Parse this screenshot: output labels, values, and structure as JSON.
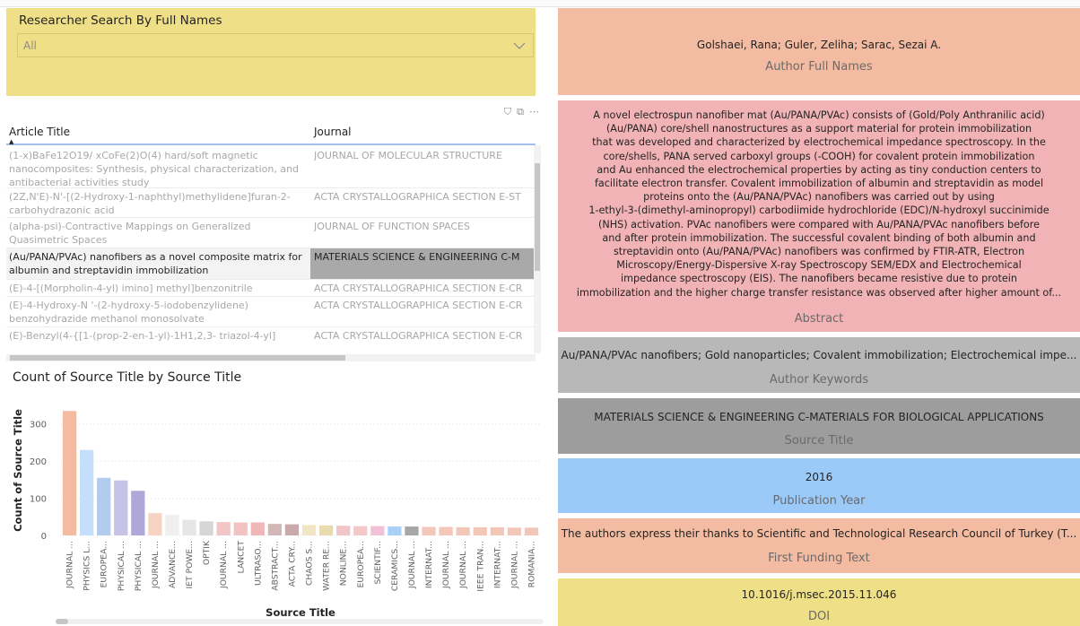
{
  "slicer": {
    "title": "Researcher Search By Full Names",
    "value": "All"
  },
  "table": {
    "headers": [
      "Article Title",
      "Journal"
    ],
    "rows": [
      {
        "title": "(1-x)BaFe12O19/ xCoFe(2)O(4) hard/soft magnetic nanocomposites: Synthesis, physical characterization, and antibacterial activities study",
        "journal": "JOURNAL OF MOLECULAR STRUCTURE"
      },
      {
        "title": "(2Z,N'E)-N'-[(2-Hydroxy-1-naphthyl)methylidene]furan-2-carbohydrazonic acid",
        "journal": "ACTA CRYSTALLOGRAPHICA SECTION E-ST"
      },
      {
        "title": "(alpha-psi)-Contractive Mappings on Generalized Quasimetric Spaces",
        "journal": "JOURNAL OF FUNCTION SPACES"
      },
      {
        "title": "(Au/PANA/PVAc) nanofibers as a novel composite matrix for albumin and streptavidin immobilization",
        "journal": "MATERIALS SCIENCE & ENGINEERING C-M"
      },
      {
        "title": "(E)-4-[(Morpholin-4-yl) imino] methyl]benzonitrile",
        "journal": "ACTA CRYSTALLOGRAPHICA SECTION E-CR"
      },
      {
        "title": "(E)-4-Hydroxy-N '-(2-hydroxy-5-iodobenzylidene) benzohydrazide methanol monosolvate",
        "journal": "ACTA CRYSTALLOGRAPHICA SECTION E-CR"
      },
      {
        "title": "(E)-Benzyl(4-{[1-(prop-2-en-1-yl)-1H1,2,3- triazol-4-yl]",
        "journal": "ACTA CRYSTALLOGRAPHICA SECTION E-CR"
      }
    ]
  },
  "chart_data": {
    "type": "bar",
    "title": "Count of Source Title by Source Title",
    "xlabel": "Source Title",
    "ylabel": "Count of Source Title",
    "ylim": [
      0,
      350
    ],
    "yticks": [
      0,
      100,
      200,
      300
    ],
    "categories": [
      "JOURNAL ...",
      "PHYSICS L...",
      "EUROPEA...",
      "PHYSICAL ...",
      "PHYSICAL ...",
      "JOURNAL ...",
      "ADVANCE...",
      "IET POWE...",
      "OPTIK",
      "JOURNAL ...",
      "LANCET",
      "ULTRASO...",
      "ABSTRACT...",
      "ACTA CRY...",
      "CHAOS S...",
      "WATER RE...",
      "NONLINE...",
      "EUROPEA...",
      "SCIENTIF...",
      "CERAMICS...",
      "JOURNAL ...",
      "INTERNAT...",
      "JOURNAL ...",
      "JOURNAL ...",
      "IEEE TRAN...",
      "INTERNAT...",
      "JOURNAL ...",
      "ROMANIA..."
    ],
    "values": [
      335,
      230,
      155,
      148,
      120,
      60,
      55,
      42,
      38,
      36,
      35,
      35,
      31,
      30,
      28,
      27,
      26,
      25,
      25,
      24,
      24,
      23,
      23,
      22,
      22,
      22,
      21,
      21
    ],
    "colors": [
      "#f3bba1",
      "#c4defb",
      "#b3cbee",
      "#c7c2e8",
      "#aea8d8",
      "#f7d3c4",
      "#efefef",
      "#e6e6e6",
      "#d6d6d6",
      "#f2c6c6",
      "#f3c3c4",
      "#f0b7b9",
      "#d3b6b6",
      "#c9a9a9",
      "#f1e5c3",
      "#e8dbb0",
      "#f2c5c8",
      "#f3c8c8",
      "#f2c1d7",
      "#a9d1f7",
      "#a7a7a7",
      "#f3c7b8",
      "#f3c7b8",
      "#f3c7b8",
      "#f3c7b8",
      "#f3c7b8",
      "#f3c7b8",
      "#f3c7b8"
    ]
  },
  "cards": {
    "author": {
      "value": "Golshaei, Rana; Guler, Zeliha; Sarac, Sezai A.",
      "label": "Author Full Names"
    },
    "abstract": {
      "lines": [
        "A novel electrospun nanofiber mat (Au/PANA/PVAc) consists of (Gold/Poly Anthranilic acid)",
        "(Au/PANA) core/shell nanostructures as a support material for protein immobilization",
        "that was developed and characterized by electrochemical impedance spectroscopy. In the",
        "core/shells, PANA served carboxyl groups (-COOH) for covalent protein immobilization",
        "and Au enhanced the electrochemical properties by acting as tiny conduction centers to",
        "facilitate electron transfer. Covalent immobilization of albumin and streptavidin as model",
        "proteins onto the (Au/PANA/PVAc) nanofibers was carried out by using",
        "1-ethyl-3-(dimethyl-aminopropyl) carbodiimide hydrochloride (EDC)/N-hydroxyl succinimide",
        "(NHS) activation. PVAc nanofibers were compared with Au/PANA/PVAc nanofibers before",
        "and after protein immobilization. The successful covalent binding of both albumin and",
        "streptavidin onto (Au/PANA/PVAc) nanofibers was confirmed by FTIR-ATR, Electron",
        "Microscopy/Energy-Dispersive X-ray Spectroscopy SEM/EDX and Electrochemical",
        "impedance spectroscopy (EIS). The nanofibers became resistive due to protein",
        "immobilization and the higher charge transfer resistance was observed after higher amount of..."
      ],
      "label": "Abstract"
    },
    "keywords": {
      "value": "Au/PANA/PVAc nanofibers; Gold nanoparticles; Covalent immobilization; Electrochemical impe...",
      "label": "Author Keywords"
    },
    "source": {
      "value": "MATERIALS SCIENCE & ENGINEERING C-MATERIALS FOR BIOLOGICAL APPLICATIONS",
      "label": "Source Title"
    },
    "year": {
      "value": "2016",
      "label": "Publication Year"
    },
    "funding": {
      "value": "The authors express their thanks to Scientific and Technological Research Council of Turkey (T...",
      "label": "First Funding Text"
    },
    "doi": {
      "value": "10.1016/j.msec.2015.11.046",
      "label": "DOI"
    }
  }
}
